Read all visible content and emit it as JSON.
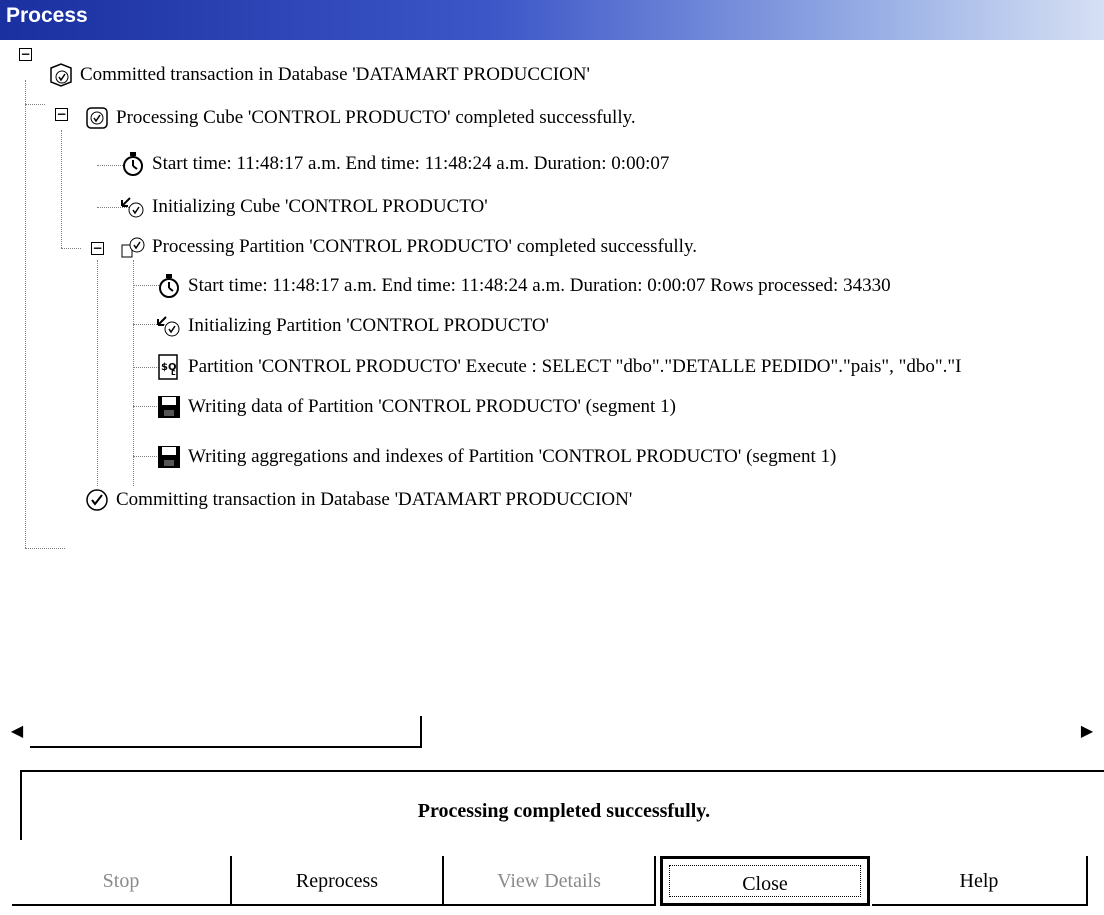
{
  "window": {
    "title": "Process"
  },
  "tree": [
    {
      "text": "Committed transaction in Database 'DATAMART PRODUCCION'",
      "icon": "commit-db-icon"
    },
    {
      "text": "Processing Cube 'CONTROL PRODUCTO' completed successfully.",
      "icon": "cube-check-icon"
    },
    {
      "text": "Start time: 11:48:17 a.m.  End time: 11:48:24 a.m.  Duration: 0:00:07",
      "icon": "stopwatch-icon"
    },
    {
      "text": "Initializing Cube 'CONTROL PRODUCTO'",
      "icon": "initialize-icon"
    },
    {
      "text": "Processing Partition 'CONTROL PRODUCTO' completed successfully.",
      "icon": "partition-check-icon"
    },
    {
      "text": "Start time: 11:48:17 a.m.  End time: 11:48:24 a.m.  Duration: 0:00:07  Rows processed: 34330",
      "icon": "stopwatch-icon"
    },
    {
      "text": "Initializing Partition 'CONTROL PRODUCTO'",
      "icon": "initialize-icon"
    },
    {
      "text": "Partition 'CONTROL PRODUCTO' Execute : SELECT \"dbo\".\"DETALLE PEDIDO\".\"pais\", \"dbo\".\"I",
      "icon": "sql-icon"
    },
    {
      "text": "Writing data of Partition 'CONTROL PRODUCTO' (segment  1)",
      "icon": "disk-icon"
    },
    {
      "text": "Writing aggregations and indexes of Partition 'CONTROL PRODUCTO' (segment  1)",
      "icon": "disk-icon"
    },
    {
      "text": "Committing transaction in Database 'DATAMART PRODUCCION'",
      "icon": "check-circle-icon"
    }
  ],
  "status": {
    "message": "Processing completed successfully."
  },
  "buttons": {
    "stop": "Stop",
    "reprocess": "Reprocess",
    "view_details": "View Details",
    "close": "Close",
    "help": "Help"
  }
}
